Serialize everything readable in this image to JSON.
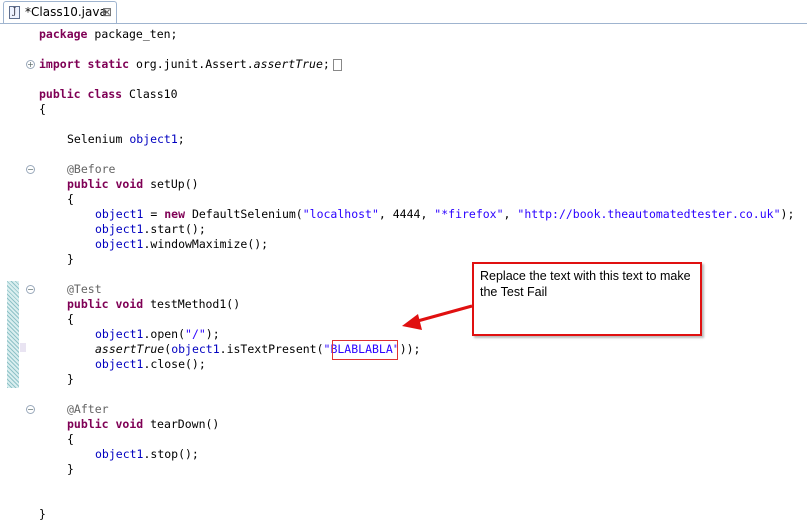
{
  "tab": {
    "title": "*Class10.java",
    "icon": "java-file-icon",
    "close_glyph": "⊠"
  },
  "code": {
    "l01": {
      "kw": "package",
      "rest": " package_ten;"
    },
    "l03": {
      "kw1": "import",
      "sp": " ",
      "kw2": "static",
      "pre": " org.junit.Assert.",
      "it": "assertTrue",
      "post": ";"
    },
    "l05": {
      "kw1": "public",
      "sp": " ",
      "kw2": "class",
      "rest": " Class10"
    },
    "l06": "{",
    "l08": {
      "type": "Selenium ",
      "field": "object1",
      "post": ";"
    },
    "l10": "@Before",
    "l11": {
      "kw1": "public",
      "sp": " ",
      "kw2": "void",
      "rest": " setUp()"
    },
    "l12": "{",
    "l13": {
      "field": "object1",
      "a": " = ",
      "kw": "new",
      "b": " DefaultSelenium(",
      "s1": "\"localhost\"",
      "c": ", 4444, ",
      "s2": "\"*firefox\"",
      "d": ", ",
      "s3": "\"http://book.theautomatedtester.co.uk\"",
      "e": ");"
    },
    "l14": {
      "field": "object1",
      "rest": ".start();"
    },
    "l15": {
      "field": "object1",
      "rest": ".windowMaximize();"
    },
    "l16": "}",
    "l18": "@Test",
    "l19": {
      "kw1": "public",
      "sp": " ",
      "kw2": "void",
      "rest": " testMethod1()"
    },
    "l20": "{",
    "l21": {
      "field": "object1",
      "a": ".open(",
      "s": "\"/\"",
      "b": ");"
    },
    "l22": {
      "it": "assertTrue",
      "a": "(",
      "field": "object1",
      "b": ".isTextPresent(",
      "q1": "\"",
      "s": "BLABLABLA",
      "q2": "\"",
      "c": "));"
    },
    "l23": {
      "field": "object1",
      "rest": ".close();"
    },
    "l24": "}",
    "l26": "@After",
    "l27": {
      "kw1": "public",
      "sp": " ",
      "kw2": "void",
      "rest": " tearDown()"
    },
    "l28": "{",
    "l29": {
      "field": "object1",
      "rest": ".stop();"
    },
    "l30": "}",
    "l33": "}"
  },
  "fold_markers": {
    "expand": "+",
    "collapse": "−"
  },
  "callout": {
    "text": "Replace the text with this text to make the Test Fail",
    "border_color": "#e01010"
  },
  "colors": {
    "keyword": "#7f0055",
    "string": "#2a00ff",
    "field": "#0000c0",
    "annotation": "#646464"
  }
}
